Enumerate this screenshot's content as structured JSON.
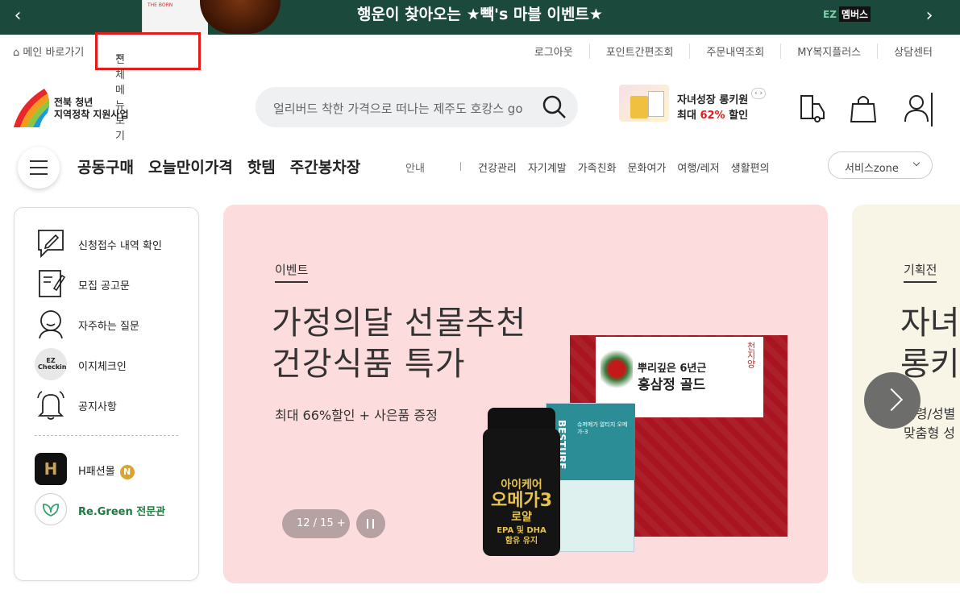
{
  "top_banner": {
    "text": "행운이 찾아오는 ★빽's 마블 이벤트★",
    "brand_ez": "EZ",
    "brand_members": "멤버스",
    "prev": "‹",
    "next": "›",
    "thumb_label": "THE BORN"
  },
  "utility": {
    "home_label": "메인 바로가기",
    "menu_label": "전체 메뉴보기",
    "links": [
      "로그아웃",
      "포인트간편조회",
      "주문내역조회",
      "MY복지플러스",
      "상담센터"
    ]
  },
  "logo": {
    "line1": "전북 청년",
    "line2": "지역정착 지원사업"
  },
  "search": {
    "placeholder": "얼리버드 착한 가격으로 떠나는 제주도 호캉스 go"
  },
  "promo": {
    "line1": "자녀성장 롱키원",
    "line2_prefix": "최대 ",
    "line2_highlight": "62%",
    "line2_suffix": " 할인",
    "nav": "‹ ›"
  },
  "gnb": {
    "main": [
      "공동구매",
      "오늘만이가격",
      "핫템",
      "주간봉차장"
    ],
    "info": "안내",
    "categories": [
      "건강관리",
      "자기계발",
      "가족친화",
      "문화여가",
      "여행/레저",
      "생활편의"
    ],
    "service_zone": "서비스zone"
  },
  "quick_menu": [
    {
      "label": "신청접수 내역 확인",
      "icon": "application-pen-icon"
    },
    {
      "label": "모집 공고문",
      "icon": "notice-document-icon"
    },
    {
      "label": "자주하는 질문",
      "icon": "faq-person-icon"
    },
    {
      "label": "이지체크인",
      "icon": "ez-checkin-icon",
      "icon_text": "EZ Checkin"
    },
    {
      "label": "공지사항",
      "icon": "bell-icon"
    },
    {
      "label": "H패션몰",
      "icon": "h-fashion-icon",
      "icon_text": "H",
      "badge": "N"
    },
    {
      "label": "Re.Green 전문관",
      "icon": "regreen-leaf-icon"
    }
  ],
  "hero": {
    "tag": "이벤트",
    "title_line1": "가정의달 선물추천",
    "title_line2": "건강식품 특가",
    "subtitle": "최대 66%할인 + 사은품 증정",
    "counter": "12 / 15  +",
    "product_redbox_line1": "뿌리깊은 6년근",
    "product_redbox_line2": "홍삼정 골드",
    "product_redbox_seal": "천지양",
    "product_teal_brand": "BESTURE",
    "product_teal_name": "슈퍼메가 알티지 오메가-3",
    "product_bottle_line1": "아이케어",
    "product_bottle_line2": "오메가3",
    "product_bottle_line3": "로얄",
    "product_bottle_line4": "EPA 및 DHA",
    "product_bottle_line5": "함유 유지"
  },
  "next_card": {
    "tag": "기획전",
    "title_line1": "자녀",
    "title_line2": "롱키",
    "sub_line1": "연령/성별",
    "sub_line2": "맞춤형 성"
  },
  "colors": {
    "banner_bg": "#1b4a3c",
    "hero_bg": "#fcdcdc",
    "highlight_red": "#e31c1c",
    "next_card_bg": "#f8f5e7"
  }
}
